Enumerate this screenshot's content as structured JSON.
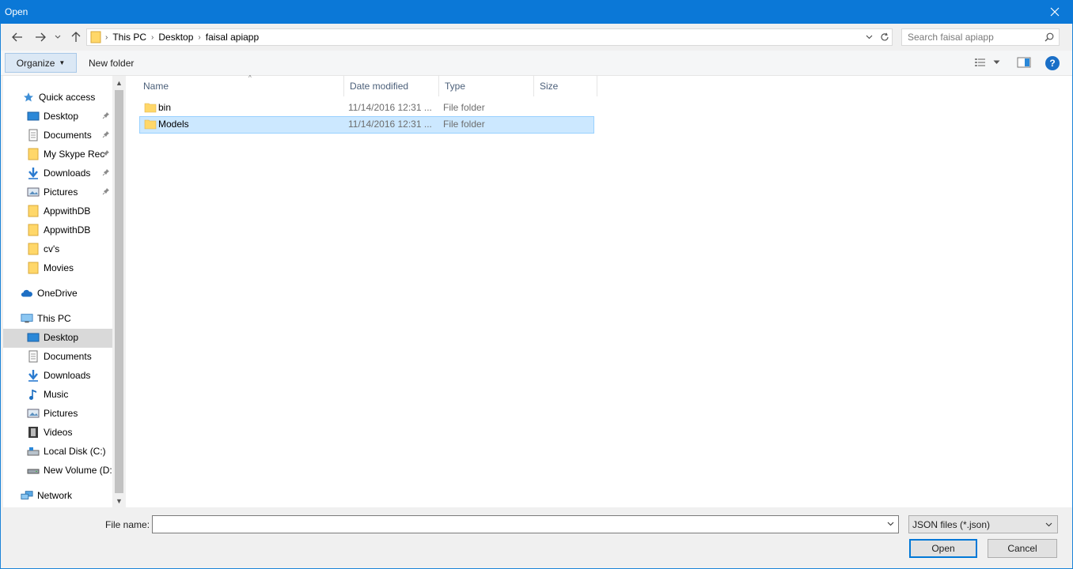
{
  "window": {
    "title": "Open"
  },
  "address": {
    "breadcrumbs": [
      "This PC",
      "Desktop",
      "faisal apiapp"
    ]
  },
  "search": {
    "placeholder": "Search faisal apiapp"
  },
  "toolbar": {
    "organize_label": "Organize",
    "new_folder_label": "New folder",
    "help_label": "?"
  },
  "nav": {
    "quick_access": "Quick access",
    "qa_items": [
      {
        "label": "Desktop",
        "icon": "desktop-icon"
      },
      {
        "label": "Documents",
        "icon": "documents-icon"
      },
      {
        "label": "My Skype Rec",
        "icon": "folder-icon"
      },
      {
        "label": "Downloads",
        "icon": "downloads-icon"
      },
      {
        "label": "Pictures",
        "icon": "pictures-icon"
      },
      {
        "label": "AppwithDB",
        "icon": "folder-icon"
      },
      {
        "label": "AppwithDB",
        "icon": "folder-icon"
      },
      {
        "label": "cv's",
        "icon": "folder-icon"
      },
      {
        "label": "Movies",
        "icon": "folder-icon"
      }
    ],
    "onedrive": "OneDrive",
    "this_pc": "This PC",
    "pc_items": [
      {
        "label": "Desktop",
        "icon": "desktop-icon"
      },
      {
        "label": "Documents",
        "icon": "documents-icon"
      },
      {
        "label": "Downloads",
        "icon": "downloads-icon"
      },
      {
        "label": "Music",
        "icon": "music-icon"
      },
      {
        "label": "Pictures",
        "icon": "pictures-icon"
      },
      {
        "label": "Videos",
        "icon": "videos-icon"
      },
      {
        "label": "Local Disk (C:)",
        "icon": "disk-icon"
      },
      {
        "label": "New Volume (D:)",
        "icon": "drive-icon"
      }
    ],
    "network": "Network"
  },
  "columns": {
    "name": "Name",
    "date": "Date modified",
    "type": "Type",
    "size": "Size"
  },
  "files": [
    {
      "name": "bin",
      "date": "11/14/2016 12:31 ...",
      "type": "File folder",
      "selected": false
    },
    {
      "name": "Models",
      "date": "11/14/2016 12:31 ...",
      "type": "File folder",
      "selected": true
    }
  ],
  "footer": {
    "file_name_label": "File name:",
    "file_name_value": "",
    "filter_label": "JSON files (*.json)",
    "open_label": "Open",
    "cancel_label": "Cancel"
  }
}
